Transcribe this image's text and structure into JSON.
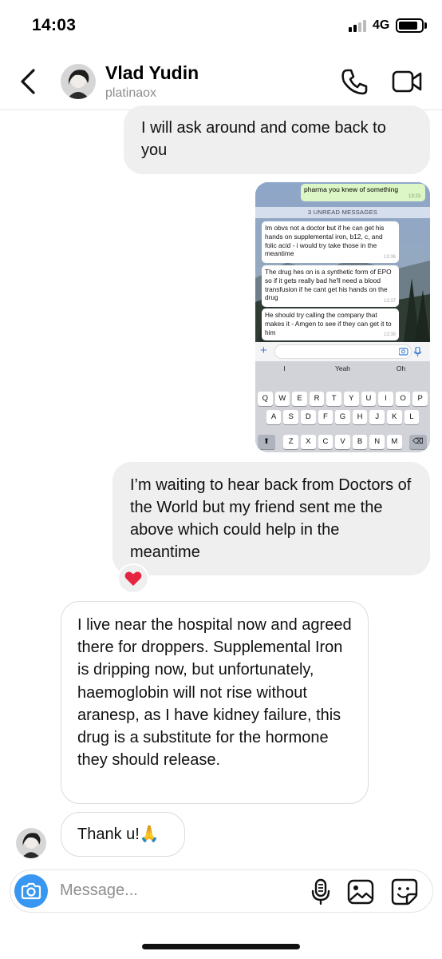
{
  "status_bar": {
    "time": "14:03",
    "network": "4G",
    "battery_level": 0.85
  },
  "header": {
    "contact_name": "Vlad Yudin",
    "username": "platinaox"
  },
  "messages": [
    {
      "text": "I will ask around and come back to you"
    },
    {
      "text": "I’m waiting to hear back from Doctors of the World but my friend sent me the above which could help in the meantime"
    },
    {
      "text": "I live near the hospital now and agreed there for droppers. Supplemental Iron is dripping now, but unfortunately, haemoglobin will not rise without aranesp, as I have kidney failure, this drug is a substitute for the hormone they should release."
    },
    {
      "text": "Thank u!🙏"
    }
  ],
  "reaction": "❤️",
  "screenshot": {
    "outgoing": {
      "text": "pharma you knew of something",
      "time": "13:23"
    },
    "unread_banner": "3 UNREAD MESSAGES",
    "incoming": [
      {
        "text": "Im obvs not a doctor but if he can get his hands on supplemental iron, b12, c, and folic acid - i would try take those in the meantime",
        "time": "13:36"
      },
      {
        "text": "The drug hes on is a synthetic form of EPO so if it gets really bad he'll need a blood transfusion if he cant get his hands on the drug",
        "time": "13:37"
      },
      {
        "text": "He should try calling the company that makes it - Amgen to see if they can get it to him",
        "time": "13:38"
      }
    ],
    "suggestions": [
      "I",
      "Yeah",
      "Oh"
    ],
    "keyboard_rows": [
      [
        "Q",
        "W",
        "E",
        "R",
        "T",
        "Y",
        "U",
        "I",
        "O",
        "P"
      ],
      [
        "A",
        "S",
        "D",
        "F",
        "G",
        "H",
        "J",
        "K",
        "L"
      ],
      [
        "Z",
        "X",
        "C",
        "V",
        "B",
        "N",
        "M"
      ]
    ]
  },
  "composer": {
    "placeholder": "Message..."
  }
}
